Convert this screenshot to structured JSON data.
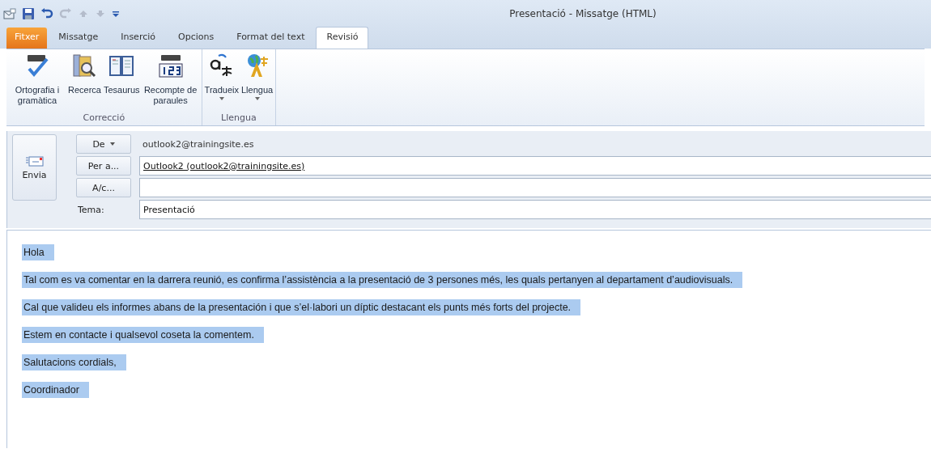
{
  "window": {
    "title": "Presentació - Missatge (HTML)"
  },
  "quick_access": [
    {
      "kind": "mail"
    },
    {
      "kind": "save"
    },
    {
      "kind": "undo",
      "disabled": false
    },
    {
      "kind": "redo",
      "disabled": true
    },
    {
      "kind": "up",
      "disabled": true
    },
    {
      "kind": "down",
      "disabled": true
    },
    {
      "kind": "customize",
      "disabled": false
    }
  ],
  "tabs": [
    {
      "label": "Fitxer",
      "kind": "file",
      "selected": false
    },
    {
      "label": "Missatge",
      "kind": "tab",
      "selected": false
    },
    {
      "label": "Inserció",
      "kind": "tab",
      "selected": false
    },
    {
      "label": "Opcions",
      "kind": "tab",
      "selected": false
    },
    {
      "label": "Format del text",
      "kind": "tab",
      "selected": false
    },
    {
      "label": "Revisió",
      "kind": "tab",
      "selected": true
    }
  ],
  "ribbon_groups": [
    {
      "label": "Correcció",
      "buttons": [
        {
          "label": "Ortografia i gramàtica",
          "kind": "spelling",
          "dropdown": false
        },
        {
          "label": "Recerca",
          "kind": "research",
          "dropdown": false
        },
        {
          "label": "Tesaurus",
          "kind": "thesaurus",
          "dropdown": false
        },
        {
          "label": "Recompte de paraules",
          "kind": "wordcount",
          "dropdown": false
        }
      ]
    },
    {
      "label": "Llengua",
      "buttons": [
        {
          "label": "Tradueix",
          "kind": "translate",
          "dropdown": true
        },
        {
          "label": "Llengua",
          "kind": "language",
          "dropdown": true
        }
      ]
    }
  ],
  "header": {
    "send_button": "Envia",
    "from": {
      "button": "De",
      "value": "outlook2@trainingsite.es"
    },
    "to": {
      "button": "Per a...",
      "value": "Outlook2 (outlook2@trainingsite.es)"
    },
    "cc": {
      "button": "A/c..."
    },
    "subject": {
      "label": "Tema:",
      "value": "Presentació"
    }
  },
  "body": {
    "selected": true,
    "paragraphs": [
      "Hola",
      "Tal com es va comentar en la darrera reunió, es confirma l’assistència a la presentació de 3 persones més, les quals pertanyen al departament  d’audiovisuals.",
      "Cal que valideu els informes abans de la presentación i que s’el·labori un díptic destacant  els punts més forts del projecte.",
      "Estem en contacte i qualsevol coseta la comentem.",
      "Salutacions cordials,",
      "Coordinador"
    ]
  }
}
